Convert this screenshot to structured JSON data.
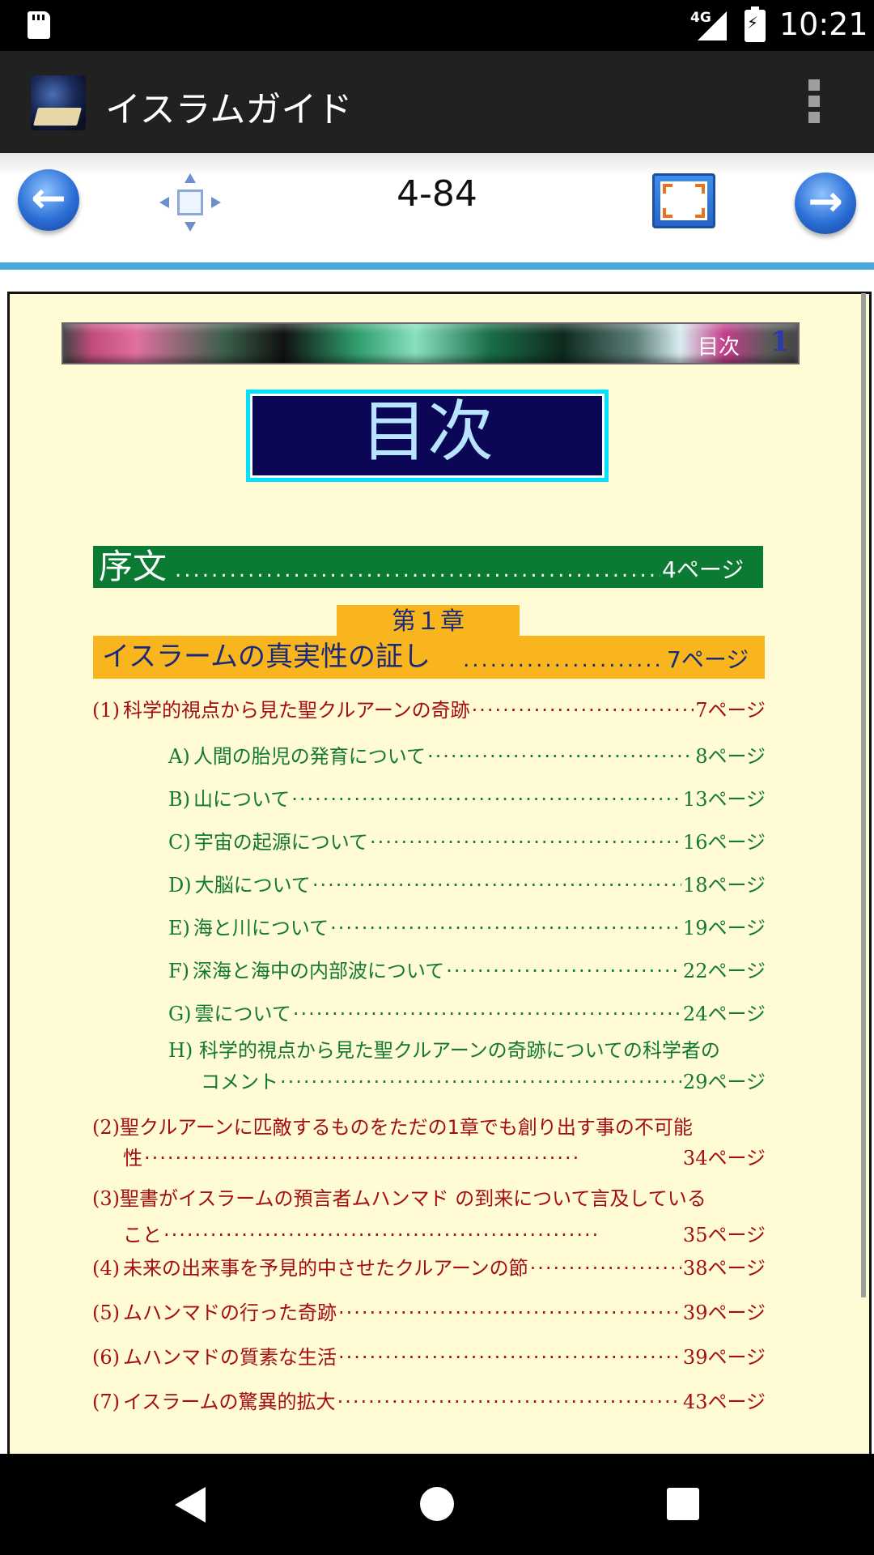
{
  "status_bar": {
    "network": "4G",
    "time": "10:21"
  },
  "app_bar": {
    "title": "イスラムガイド"
  },
  "toolbar": {
    "page_number": "4-84"
  },
  "document": {
    "banner_label": "目次",
    "banner_number": "1",
    "title": "目次",
    "preface": {
      "title": "序文",
      "page": "4ページ"
    },
    "chapter": {
      "tab": "第１章",
      "title": "イスラームの真実性の証し",
      "page": "7ページ"
    },
    "entries": [
      {
        "num": "(1)",
        "text": "科学的視点から見た聖クルアーンの奇跡",
        "page": "7",
        "unit": "ページ"
      },
      {
        "num": "A)",
        "text": "人間の胎児の発育について",
        "page": "8",
        "unit": "ページ"
      },
      {
        "num": "B)",
        "text": "山について",
        "page": "13",
        "unit": "ページ"
      },
      {
        "num": "C)",
        "text": "宇宙の起源について",
        "page": "16",
        "unit": "ページ"
      },
      {
        "num": "D)",
        "text": "大脳について",
        "page": "18",
        "unit": "ページ"
      },
      {
        "num": "E)",
        "text": "海と川について",
        "page": "19",
        "unit": "ページ"
      },
      {
        "num": "F)",
        "text": "深海と海中の内部波について",
        "page": "22",
        "unit": "ページ"
      },
      {
        "num": "G)",
        "text": "雲について",
        "page": "24",
        "unit": "ページ"
      },
      {
        "num": "H)",
        "text_line1": "科学的視点から見た聖クルアーンの奇跡についての科学者の",
        "text_line2": "コメント",
        "page": "29",
        "unit": "ページ"
      },
      {
        "num": "(2)",
        "text_line1": "聖クルアーンに匹敵するものをただの1章でも創り出す事の不可能",
        "text_line2": "性",
        "page": "34",
        "unit": "ページ"
      },
      {
        "num": "(3)",
        "text_line1": "聖書がイスラームの預言者ムハンマド の到来について言及している",
        "text_line2": "こと",
        "page": "35",
        "unit": "ページ"
      },
      {
        "num": "(4)",
        "text": "未来の出来事を予見的中させたクルアーンの節",
        "page": "38",
        "unit": "ページ"
      },
      {
        "num": "(5)",
        "text": "ムハンマドの行った奇跡",
        "page": "39",
        "unit": "ページ"
      },
      {
        "num": "(6)",
        "text": "ムハンマドの質素な生活",
        "page": "39",
        "unit": "ページ"
      },
      {
        "num": "(7)",
        "text": "イスラームの驚異的拡大",
        "page": "43",
        "unit": "ページ"
      }
    ]
  }
}
